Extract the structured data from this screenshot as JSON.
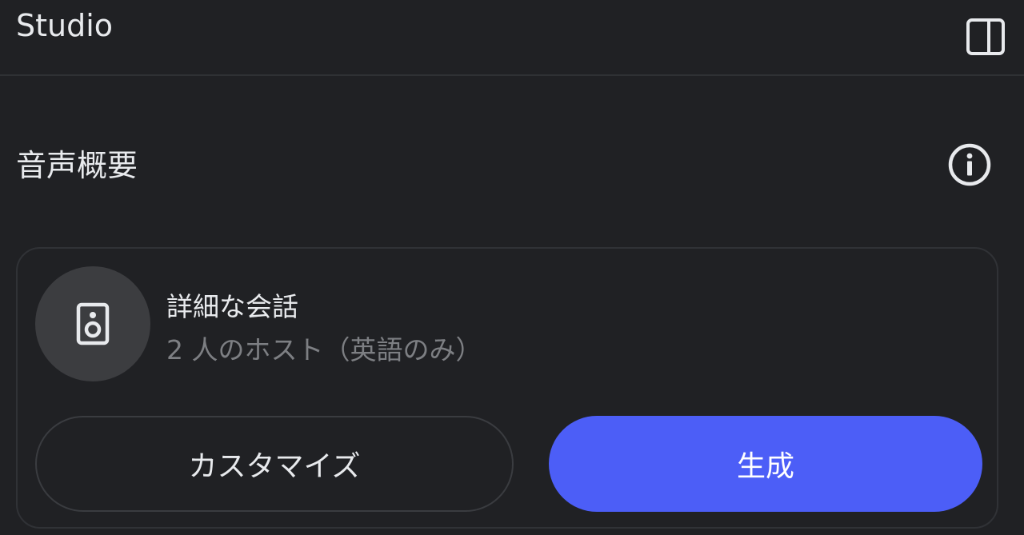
{
  "header": {
    "title": "Studio",
    "toggle_icon": "side-panel-icon"
  },
  "audio_overview": {
    "title": "音声概要",
    "info_icon": "info-icon",
    "card": {
      "icon": "speaker-icon",
      "title": "詳細な会話",
      "subtitle": "2 人のホスト（英語のみ）",
      "customize_label": "カスタマイズ",
      "generate_label": "生成"
    }
  },
  "colors": {
    "background": "#202124",
    "card_border": "#303236",
    "primary_button": "#4c5ef7",
    "avatar_bg": "#3c3d40",
    "muted_text": "#7d7f83"
  }
}
